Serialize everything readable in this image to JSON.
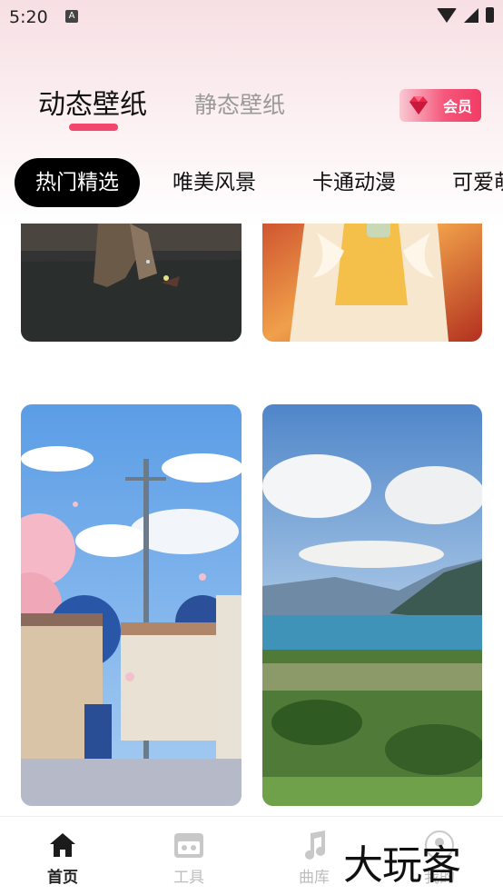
{
  "status_bar": {
    "time": "5:20",
    "notification_icon": "A"
  },
  "tabs": {
    "active": "动态壁纸",
    "inactive": "静态壁纸"
  },
  "vip_badge": {
    "label": "会员",
    "icon": "gem-icon"
  },
  "categories": [
    "热门精选",
    "唯美风景",
    "卡通动漫",
    "可爱萌"
  ],
  "wallpapers": [
    {
      "id": "card-1",
      "desc": "dark anime figure"
    },
    {
      "id": "card-2",
      "desc": "girl with drink"
    },
    {
      "id": "card-3",
      "desc": "anime street with cherry blossoms"
    },
    {
      "id": "card-4",
      "desc": "lake landscape"
    }
  ],
  "bottom_nav": [
    {
      "label": "首页",
      "icon": "home-icon",
      "active": true
    },
    {
      "label": "工具",
      "icon": "toolbox-icon",
      "active": false
    },
    {
      "label": "曲库",
      "icon": "music-note-icon",
      "active": false
    },
    {
      "label": "我的",
      "icon": "profile-icon",
      "active": false
    }
  ],
  "watermark": "大玩客",
  "colors": {
    "accent": "#f2466f",
    "selected_chip": "#000000"
  }
}
